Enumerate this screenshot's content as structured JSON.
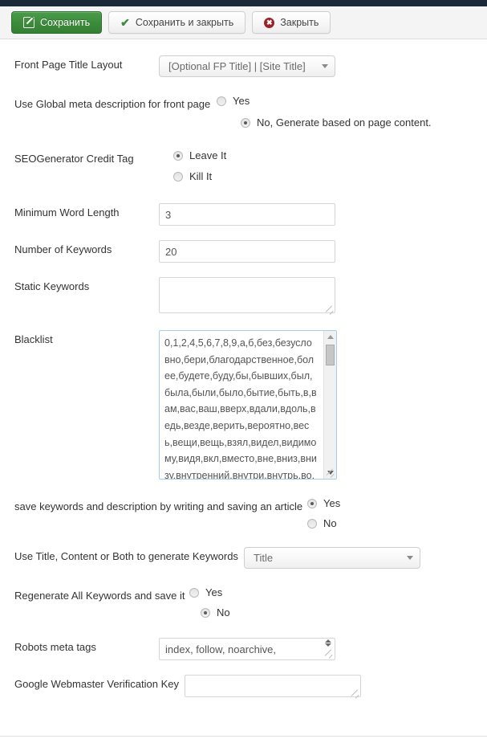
{
  "toolbar": {
    "buttons": [
      {
        "label": "Сохранить",
        "icon": "pencil-square-icon",
        "style": "primary"
      },
      {
        "label": "Сохранить и закрыть",
        "icon": "check-icon",
        "style": "default"
      },
      {
        "label": "Закрыть",
        "icon": "close-circle-icon",
        "style": "default"
      }
    ]
  },
  "colors": {
    "primary_button": "#3c8c3c",
    "topbar": "#1b2838",
    "focus_border": "#a8cdea",
    "close_icon": "#9b2226"
  },
  "form": {
    "front_page_title_layout": {
      "label": "Front Page Title Layout",
      "value": "[Optional FP Title] | [Site Title]"
    },
    "use_global_meta_description": {
      "label": "Use Global meta description for front page",
      "options": [
        {
          "label": "Yes",
          "selected": false
        },
        {
          "label": "No, Generate based on page content.",
          "selected": true
        }
      ]
    },
    "seogenerator_credit_tag": {
      "label": "SEOGenerator Credit Tag",
      "options": [
        {
          "label": "Leave It",
          "selected": true
        },
        {
          "label": "Kill It",
          "selected": false
        }
      ]
    },
    "minimum_word_length": {
      "label": "Minimum Word Length",
      "value": "3"
    },
    "number_of_keywords": {
      "label": "Number of Keywords",
      "value": "20"
    },
    "static_keywords": {
      "label": "Static Keywords",
      "value": ""
    },
    "blacklist": {
      "label": "Blacklist",
      "value": "0,1,2,4,5,6,7,8,9,а,б,без,безусловно,бери,благодарственное,более,будете,буду,бы,бывших,был,была,были,было,бытие,быть,в,вам,вас,ваш,вверх,вдали,вдоль,ведь,везде,верить,вероятно,весь,вещи,вещь,взял,видел,видимому,видя,вкл,вместо,вне,вниз,внизу,внутренний,внутри,внутрь,во,возможно,вокруг"
    },
    "save_keywords_on_article_save": {
      "label": "save keywords and description by writing and saving an article",
      "options": [
        {
          "label": "Yes",
          "selected": true
        },
        {
          "label": "No",
          "selected": false
        }
      ]
    },
    "keyword_source": {
      "label": "Use Title, Content or Both to generate Keywords",
      "value": "Title"
    },
    "regenerate_all_keywords": {
      "label": "Regenerate All Keywords and save it",
      "options": [
        {
          "label": "Yes",
          "selected": false
        },
        {
          "label": "No",
          "selected": true
        }
      ]
    },
    "robots_meta_tags": {
      "label": "Robots meta tags",
      "value": "index, follow, noarchive,"
    },
    "google_webmaster_verification_key": {
      "label": "Google Webmaster Verification Key",
      "value": ""
    }
  }
}
